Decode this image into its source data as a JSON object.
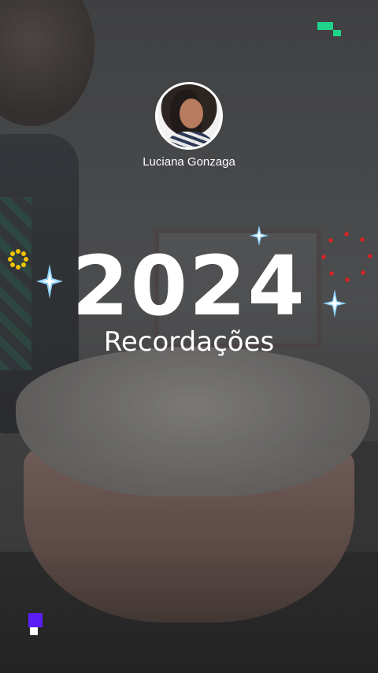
{
  "profile": {
    "name": "Luciana Gonzaga"
  },
  "headline": {
    "year": "2024",
    "title": "Recordações"
  },
  "decorations": {
    "colors": {
      "green": "#1fd38a",
      "purple": "#5a1ef5",
      "gold": "#f2c200",
      "red": "#e02020",
      "sparkle_blue": "#8fd3ff"
    },
    "icons": [
      "sparkle-icon",
      "sun-icon",
      "dotted-circle-icon",
      "pixel-badge-icon"
    ]
  }
}
